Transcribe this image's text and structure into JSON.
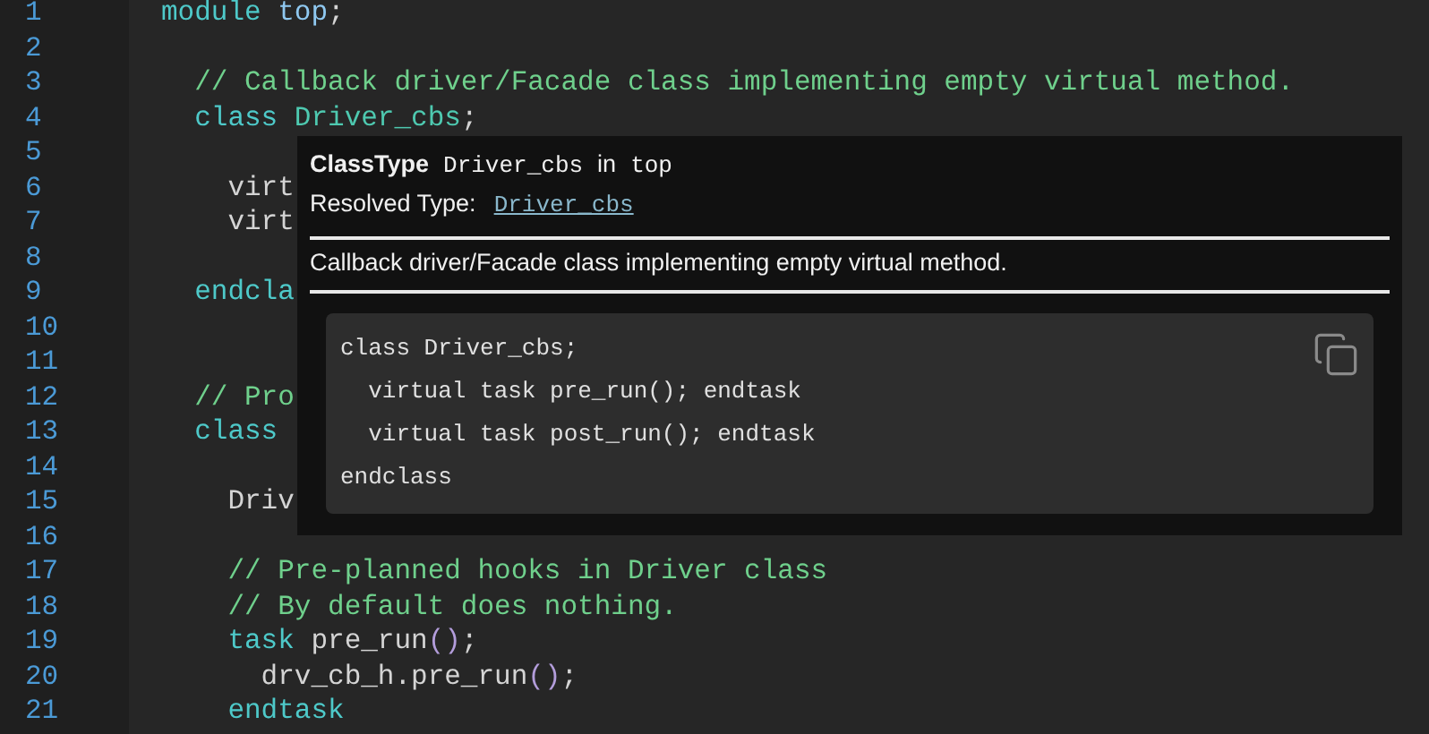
{
  "editor": {
    "lines": [
      {
        "number": "1",
        "tokens": [
          {
            "text": "module ",
            "kind": "keyword"
          },
          {
            "text": "top",
            "kind": "identifier"
          },
          {
            "text": ";",
            "kind": "plain"
          }
        ]
      },
      {
        "number": "2"
      },
      {
        "number": "3",
        "tokens": [
          {
            "text": "  // Callback driver/Facade class implementing empty virtual method.",
            "kind": "comment"
          }
        ]
      },
      {
        "number": "4",
        "tokens": [
          {
            "text": "  class ",
            "kind": "keyword"
          },
          {
            "text": "Driver_cbs",
            "kind": "type"
          },
          {
            "text": ";",
            "kind": "plain"
          }
        ]
      },
      {
        "number": "5"
      },
      {
        "number": "6",
        "tokens": [
          {
            "text": "    virt",
            "kind": "plain"
          }
        ]
      },
      {
        "number": "7",
        "tokens": [
          {
            "text": "    virt",
            "kind": "plain"
          }
        ]
      },
      {
        "number": "8"
      },
      {
        "number": "9",
        "tokens": [
          {
            "text": "  endcla",
            "kind": "keyword"
          }
        ]
      },
      {
        "number": "10"
      },
      {
        "number": "11"
      },
      {
        "number": "12",
        "tokens": [
          {
            "text": "  // Pro",
            "kind": "comment"
          }
        ]
      },
      {
        "number": "13",
        "tokens": [
          {
            "text": "  class",
            "kind": "keyword"
          }
        ]
      },
      {
        "number": "14"
      },
      {
        "number": "15",
        "tokens": [
          {
            "text": "    Driv",
            "kind": "plain"
          }
        ]
      },
      {
        "number": "16"
      },
      {
        "number": "17",
        "tokens": [
          {
            "text": "    // Pre-planned hooks in Driver class",
            "kind": "comment"
          }
        ]
      },
      {
        "number": "18",
        "tokens": [
          {
            "text": "    // By default does nothing.",
            "kind": "comment"
          }
        ]
      },
      {
        "number": "19",
        "tokens": [
          {
            "text": "    task ",
            "kind": "keyword"
          },
          {
            "text": "pre_run",
            "kind": "plain"
          },
          {
            "text": "()",
            "kind": "paren"
          },
          {
            "text": ";",
            "kind": "plain"
          }
        ]
      },
      {
        "number": "20",
        "tokens": [
          {
            "text": "      drv_cb_h.pre_run",
            "kind": "plain"
          },
          {
            "text": "()",
            "kind": "paren"
          },
          {
            "text": ";",
            "kind": "plain"
          }
        ]
      },
      {
        "number": "21",
        "tokens": [
          {
            "text": "    endtask",
            "kind": "keyword"
          }
        ]
      }
    ]
  },
  "hover": {
    "kind_label": "ClassType",
    "name": "Driver_cbs",
    "in_label": "in",
    "scope": "top",
    "resolved_label": "Resolved Type:",
    "resolved_link": "Driver_cbs",
    "description": "Callback driver/Facade class implementing empty virtual method.",
    "code_lines": [
      "class Driver_cbs;",
      "  virtual task pre_run(); endtask",
      "  virtual task post_run(); endtask",
      "endclass"
    ]
  }
}
